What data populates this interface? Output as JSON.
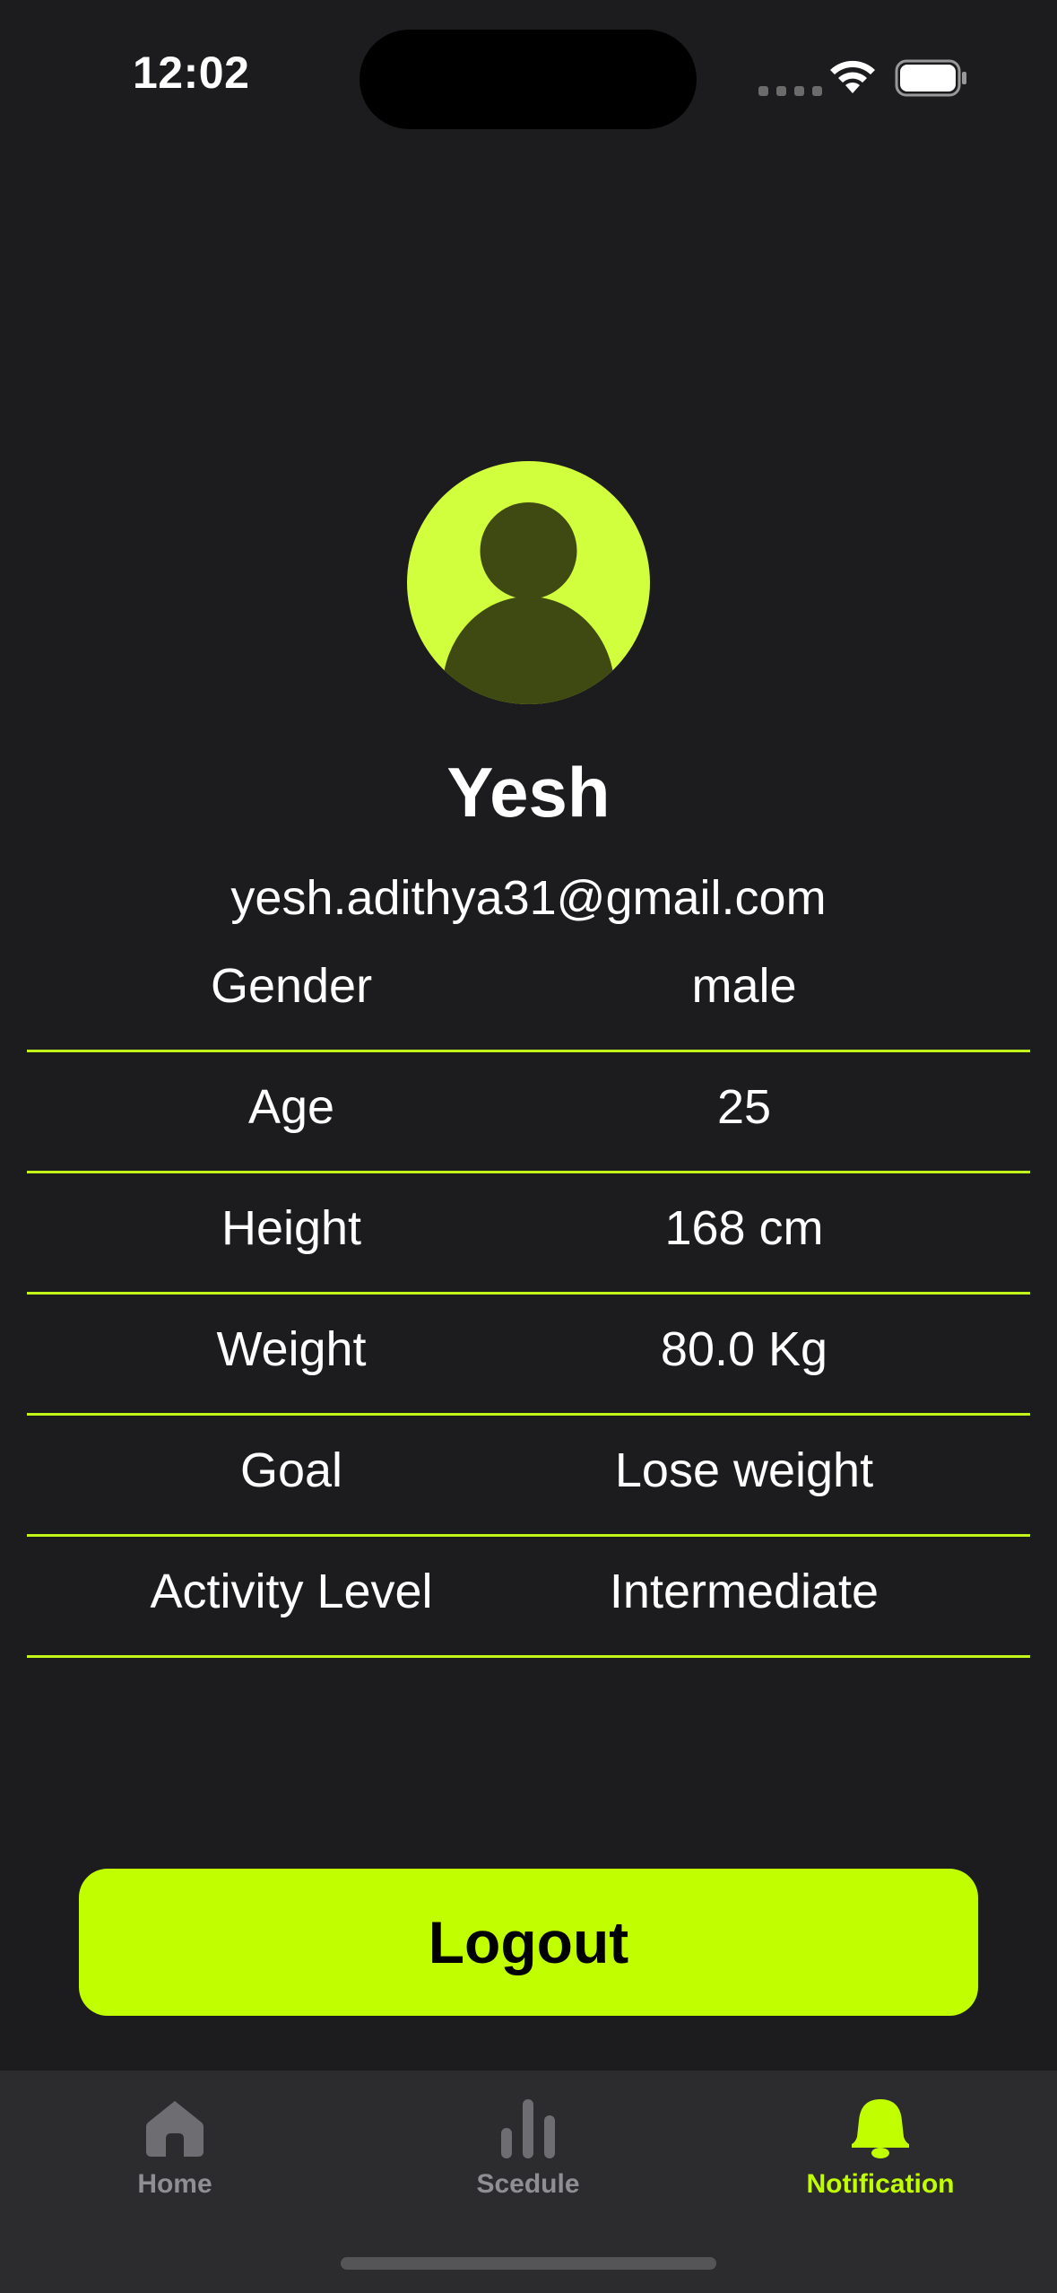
{
  "status_bar": {
    "time": "12:02"
  },
  "profile": {
    "name": "Yesh",
    "email": "yesh.adithya31@gmail.com",
    "avatar_icon": "person-icon"
  },
  "info_rows": [
    {
      "label": "Gender",
      "value": "male"
    },
    {
      "label": "Age",
      "value": "25"
    },
    {
      "label": "Height",
      "value": "168 cm"
    },
    {
      "label": "Weight",
      "value": "80.0 Kg"
    },
    {
      "label": "Goal",
      "value": "Lose weight"
    },
    {
      "label": "Activity Level",
      "value": "Intermediate"
    }
  ],
  "actions": {
    "logout_label": "Logout"
  },
  "tab_bar": {
    "tabs": [
      {
        "label": "Home",
        "icon": "home-icon",
        "active": false
      },
      {
        "label": "Scedule",
        "icon": "bar-chart-icon",
        "active": false
      },
      {
        "label": "Notification",
        "icon": "bell-icon",
        "active": true
      }
    ]
  },
  "colors": {
    "background": "#1c1c1e",
    "accent": "#c1ff00",
    "avatar_bg": "#d2ff3d",
    "avatar_fg": "#3f4a12",
    "tab_bar_bg": "#2c2c2e",
    "inactive_tab": "#8e8e93"
  }
}
